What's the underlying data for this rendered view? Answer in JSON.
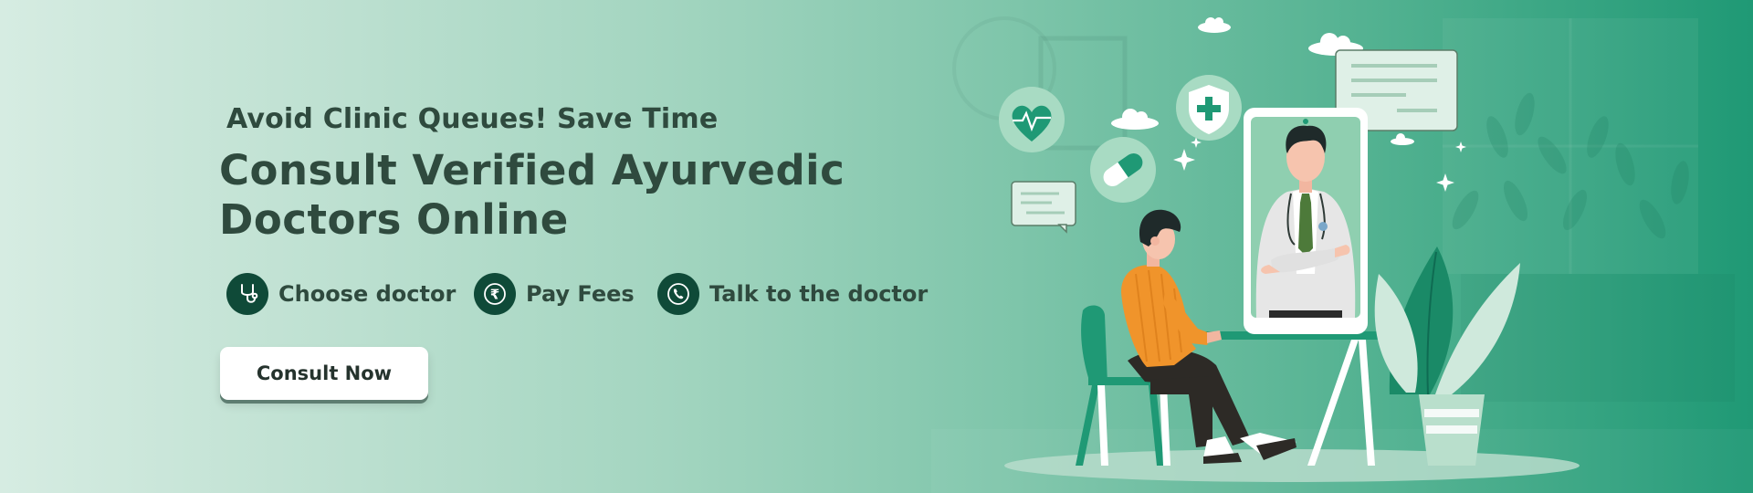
{
  "banner": {
    "kicker": "Avoid Clinic Queues! Save Time",
    "title_line1": "Consult Verified Ayurvedic",
    "title_line2": "Doctors Online",
    "steps": [
      {
        "label": "Choose doctor",
        "icon": "stethoscope-icon"
      },
      {
        "label": "Pay Fees",
        "icon": "rupee-icon"
      },
      {
        "label": "Talk to the doctor",
        "icon": "phone-icon"
      }
    ],
    "cta_label": "Consult Now"
  },
  "colors": {
    "text": "#2f4a3e",
    "icon_bg": "#0f4a38",
    "brand_green": "#1f9975",
    "button_bg": "#ffffff"
  }
}
